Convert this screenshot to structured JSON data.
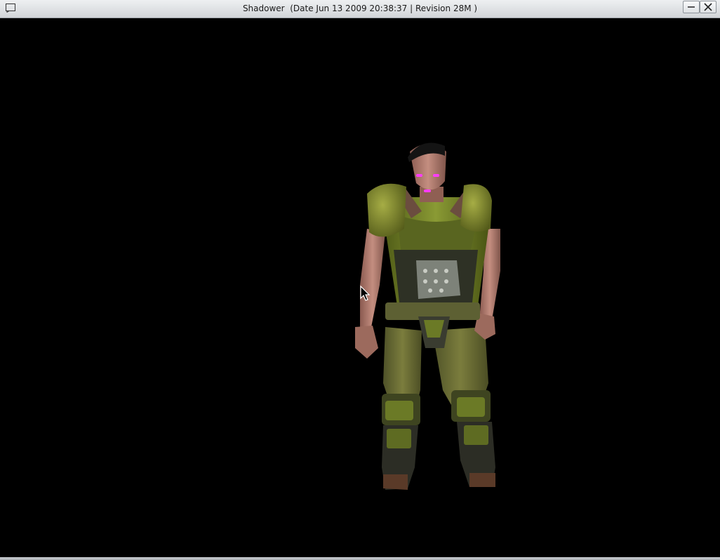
{
  "window": {
    "title": "Shadower  (Date Jun 13 2009 20:38:37 | Revision 28M )"
  },
  "icons": {
    "app": "window-icon",
    "minimize": "minimize-icon",
    "close": "close-icon",
    "cursor": "mouse-cursor-icon"
  },
  "colors": {
    "viewport_background": "#000000",
    "armor_green": "#6b7a26",
    "pants_olive": "#6e7035",
    "skin": "#b0786a",
    "eye_magenta": "#ff3cff"
  }
}
